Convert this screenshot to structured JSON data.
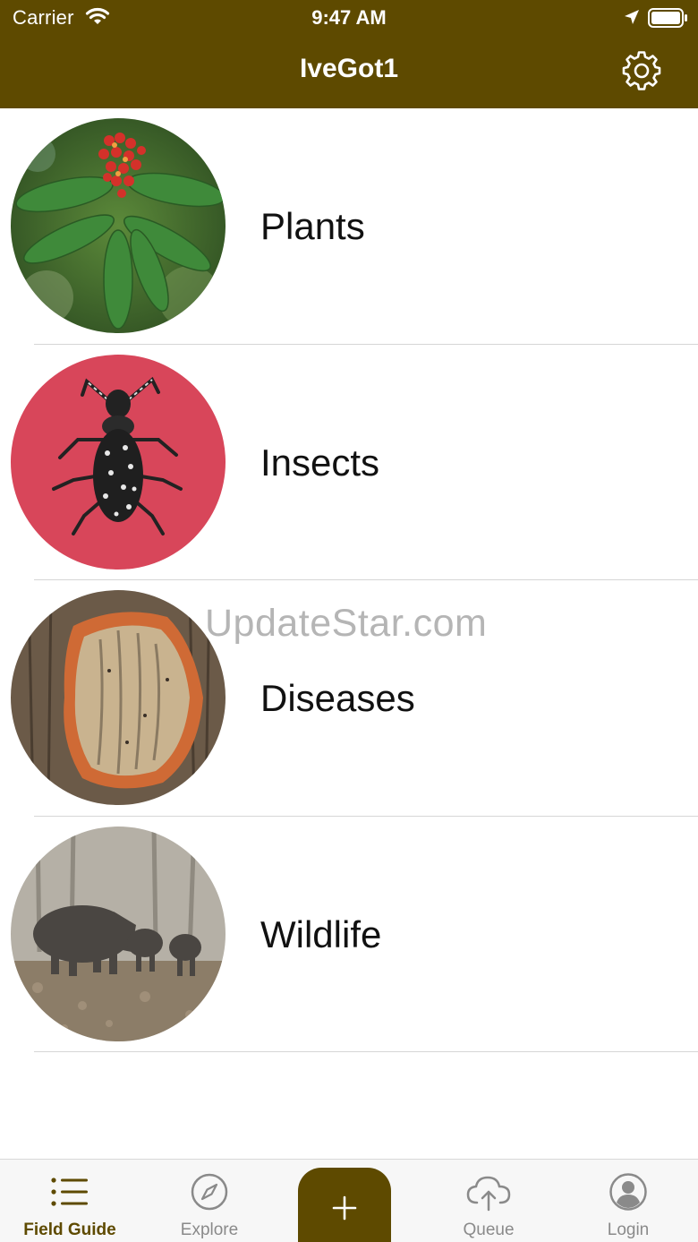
{
  "status_bar": {
    "carrier": "Carrier",
    "time": "9:47 AM"
  },
  "nav": {
    "title": "IveGot1",
    "settings_icon": "gear-icon"
  },
  "categories": [
    {
      "label": "Plants",
      "icon": "plant-photo"
    },
    {
      "label": "Insects",
      "icon": "beetle-photo"
    },
    {
      "label": "Diseases",
      "icon": "tree-bark-disease-photo"
    },
    {
      "label": "Wildlife",
      "icon": "wild-boar-photo"
    }
  ],
  "watermark": "UpdateStar.com",
  "tabbar": {
    "tabs": [
      {
        "label": "Field Guide",
        "icon": "list-icon",
        "active": true
      },
      {
        "label": "Explore",
        "icon": "compass-icon",
        "active": false
      },
      {
        "label": "Queue",
        "icon": "cloud-upload-icon",
        "active": false
      },
      {
        "label": "Login",
        "icon": "user-icon",
        "active": false
      }
    ],
    "add_icon": "plus-icon"
  },
  "colors": {
    "brand": "#5e4a00",
    "tab_inactive": "#8a8a8a",
    "background": "#ffffff"
  }
}
